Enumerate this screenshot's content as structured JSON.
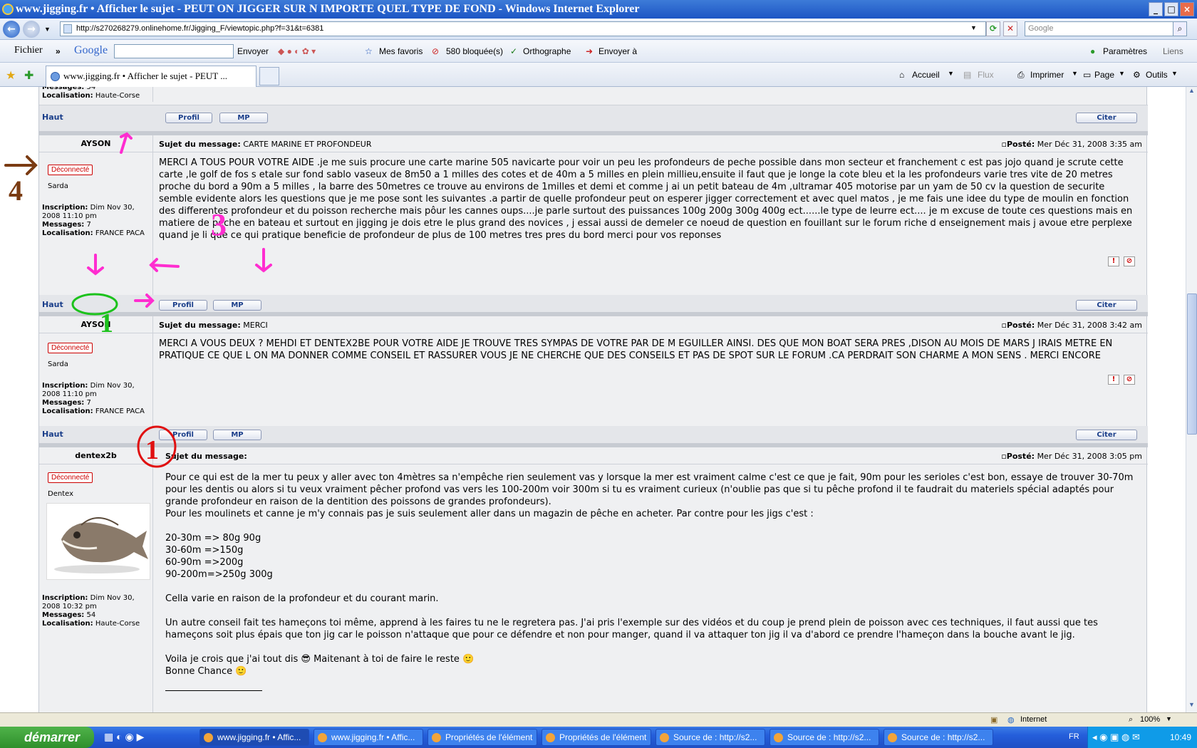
{
  "window": {
    "title": "www.jigging.fr • Afficher le sujet - PEUT ON JIGGER SUR N IMPORTE QUEL TYPE DE FOND - Windows Internet Explorer"
  },
  "address": {
    "url": "http://s270268279.onlinehome.fr/Jigging_F/viewtopic.php?f=31&t=6381",
    "search_placeholder": "Google"
  },
  "toolbar": {
    "file_menu": "Fichier",
    "google_label": "Google",
    "envoyer": "Envoyer",
    "favoris": "Mes favoris",
    "bloquees": "580 bloquée(s)",
    "orthographe": "Orthographe",
    "envoyer_a": "Envoyer à",
    "parametres": "Paramètres",
    "liens": "Liens"
  },
  "tabs": {
    "active_tab": "www.jigging.fr • Afficher le sujet - PEUT ...",
    "accueil": "Accueil",
    "flux": "Flux",
    "imprimer": "Imprimer",
    "page": "Page",
    "outils": "Outils"
  },
  "forum": {
    "haut": "Haut",
    "profil": "Profil",
    "mp": "MP",
    "citer": "Citer",
    "subject_label": "Sujet du message:",
    "posted_label": "Posté:",
    "offline": "Déconnecté",
    "inscription_label": "Inscription:",
    "messages_label": "Messages:",
    "localisation_label": "Localisation:",
    "top_partial": {
      "messages": "54",
      "localisation": "Haute-Corse"
    },
    "posts": [
      {
        "author": "AYSON",
        "rank": "Sarda",
        "subject": "CARTE MARINE ET PROFONDEUR",
        "posted": "Mer Déc 31, 2008 3:35 am",
        "inscription": "Dim Nov 30, 2008 11:10 pm",
        "messages": "7",
        "localisation": "FRANCE PACA",
        "body": "MERCI A TOUS POUR VOTRE AIDE .je me suis procure une carte marine 505 navicarte pour voir un peu les profondeurs de peche possible dans mon secteur et franchement c est pas jojo quand je scrute cette carte ,le golf de fos s etale sur fond sablo vaseux de 8m50 a 1 milles des cotes et de 40m a 5 milles en plein millieu,ensuite il faut que je longe la cote bleu et la les profondeurs varie tres vite de 20 metres proche du bord a 90m a 5 milles , la barre des 50metres ce trouve au environs de 1milles et demi et comme j ai un petit bateau de 4m ,ultramar 405 motorise par un yam de 50 cv la question de securite semble evidente alors les questions que je me pose sont les suivantes .a partir de quelle profondeur peut on esperer jigger correctement et avec quel matos , je me fais une idee du type de moulin en fonction des differentes profondeur et du poisson recherche mais pôur les cannes oups....je parle surtout des puissances 100g 200g 300g 400g ect......le type de leurre ect.... je m excuse de toute ces questions mais en matiere de peche en bateau et surtout en jigging je dois etre le plus grand des novices , j essai aussi de demeler ce noeud de question en fouillant sur le forum riche d enseignement mais j avoue etre perplexe quand je li que ce qui pratique beneficie de profondeur de plus de 100 metres tres pres du bord merci pour vos reponses"
      },
      {
        "author": "AYSON",
        "rank": "Sarda",
        "subject": "MERCI",
        "posted": "Mer Déc 31, 2008 3:42 am",
        "inscription": "Dim Nov 30, 2008 11:10 pm",
        "messages": "7",
        "localisation": "FRANCE PACA",
        "body": "MERCI A VOUS DEUX ? MEHDI ET DENTEX2BE POUR VOTRE AIDE JE TROUVE TRES SYMPAS DE VOTRE PAR DE M EGUILLER AINSI. DES QUE MON BOAT SERA PRES ,DISON AU MOIS DE MARS J IRAIS METRE EN PRATIQUE CE QUE L ON MA DONNER COMME CONSEIL ET RASSURER VOUS JE NE CHERCHE QUE DES CONSEILS ET PAS DE SPOT SUR LE FORUM .CA PERDRAIT SON CHARME A MON SENS . MERCI ENCORE"
      },
      {
        "author": "dentex2b",
        "rank": "Dentex",
        "subject": "",
        "posted": "Mer Déc 31, 2008 3:05 pm",
        "inscription": "Dim Nov 30, 2008 10:32 pm",
        "messages": "54",
        "localisation": "Haute-Corse",
        "body_lines": [
          "Pour ce qui est de la mer tu peux y aller avec ton 4mètres sa n'empêche rien seulement vas y lorsque la mer est vraiment calme c'est ce que je fait, 90m pour les serioles c'est bon, essaye de trouver 30-70m pour les dentis ou alors si tu veux vraiment pêcher profond vas vers les 100-200m voir 300m si tu es vraiment curieux (n'oublie pas que si tu pêche profond il te faudrait du materiels spécial adaptés pour grande profondeur en raison de la dentition des poissons de grandes profondeurs).",
          "Pour les moulinets et canne je m'y connais pas je suis seulement aller dans un magazin de pêche en acheter. Par contre pour les jigs c'est :",
          "",
          "20-30m => 80g 90g",
          "30-60m =>150g",
          "60-90m =>200g",
          "90-200m=>250g 300g",
          "",
          "Cella varie en raison de la profondeur et du courant marin.",
          "",
          "Un autre conseil fait tes hameçons toi même, apprend à les faires tu ne le regretera pas. J'ai pris l'exemple sur des vidéos et du coup je prend plein de poisson avec ces techniques, il faut aussi que tes hameçons soit plus épais que ton jig car le poisson n'attaque que pour ce défendre et non pour manger, quand il va attaquer ton jig il va d'abord ce prendre l'hameçon dans la bouche avant le jig.",
          "",
          "Voila je crois que j'ai tout dis 😎 Maitenant à toi de faire le reste 🙂",
          "Bonne Chance 🙂"
        ]
      }
    ]
  },
  "annotations": {
    "n1": "1",
    "n1b": "1",
    "n3": "3",
    "n4": "4"
  },
  "status": {
    "zone": "Internet",
    "zoom": "100%"
  },
  "taskbar": {
    "start": "démarrer",
    "tasks": [
      "www.jigging.fr • Affic...",
      "www.jigging.fr • Affic...",
      "Propriétés de l'élément",
      "Propriétés de l'élément",
      "Source de : http://s2...",
      "Source de : http://s2...",
      "Source de : http://s2..."
    ],
    "lang": "FR",
    "clock": "10:49"
  }
}
